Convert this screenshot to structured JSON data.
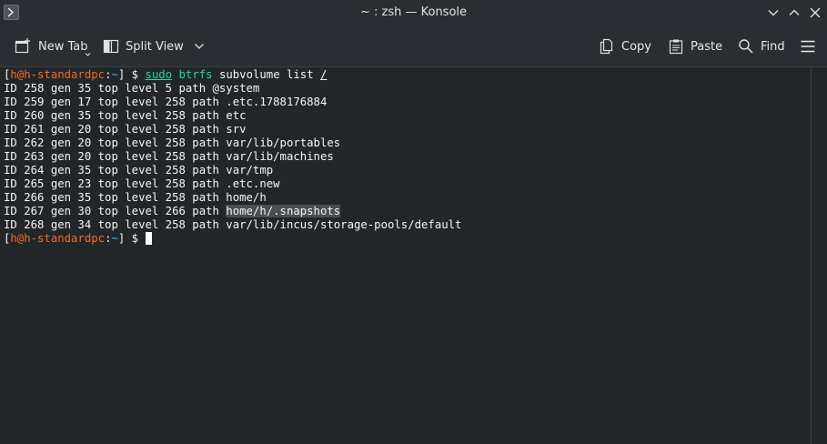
{
  "window": {
    "title": "~ : zsh — Konsole"
  },
  "toolbar": {
    "new_tab": "New Tab",
    "split_view": "Split View",
    "copy": "Copy",
    "paste": "Paste",
    "find": "Find"
  },
  "terminal": {
    "prompt": {
      "open": "[",
      "user": "h@h-standardpc",
      "colon": ":",
      "cwd": "~",
      "close": "]",
      "dollar": " $ "
    },
    "command": {
      "sudo": "sudo",
      "btrfs": "btrfs",
      "args": "subvolume list",
      "path": "/"
    },
    "output": [
      "ID 258 gen 35 top level 5 path @system",
      "ID 259 gen 17 top level 258 path .etc.1788176884",
      "ID 260 gen 35 top level 258 path etc",
      "ID 261 gen 20 top level 258 path srv",
      "ID 262 gen 20 top level 258 path var/lib/portables",
      "ID 263 gen 20 top level 258 path var/lib/machines",
      "ID 264 gen 35 top level 258 path var/tmp",
      "ID 265 gen 23 top level 258 path .etc.new",
      "ID 266 gen 35 top level 258 path home/h"
    ],
    "selected_line": {
      "prefix": "ID 267 gen 30 top level 266 path ",
      "selection": "home/h/.snapshots"
    },
    "last_line": "ID 268 gen 34 top level 258 path var/lib/incus/storage-pools/default"
  },
  "colors": {
    "background": "#232629",
    "user": "#ed6d29",
    "cwd": "#3daee9",
    "command": "#1cdc9a",
    "selection": "#4a4e53"
  }
}
